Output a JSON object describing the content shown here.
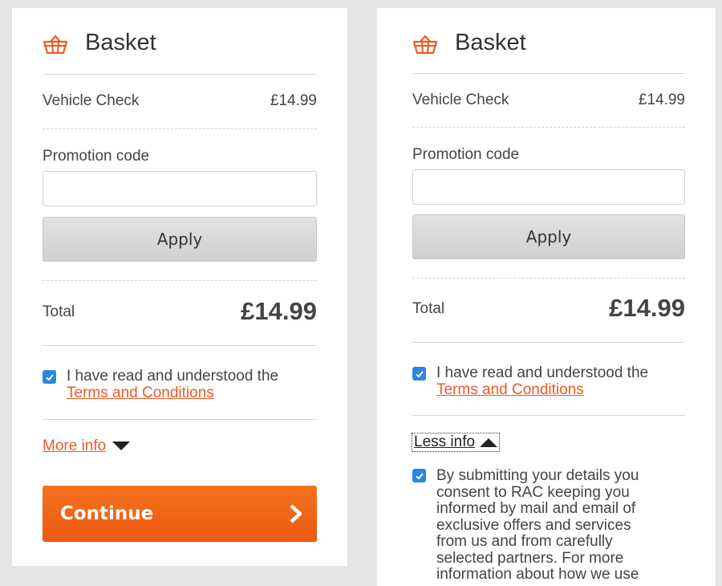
{
  "colors": {
    "accent": "#ee5a24",
    "checkbox": "#2a86e0",
    "continue_button": "#f26a1b",
    "apply_button": "#d8d8d8"
  },
  "left_panel": {
    "title": "Basket",
    "icon": "basket-icon",
    "item": {
      "label": "Vehicle Check",
      "price": "£14.99"
    },
    "promotion": {
      "label": "Promotion code",
      "value": "",
      "placeholder": ""
    },
    "apply_label": "Apply",
    "total": {
      "label": "Total",
      "value": "£14.99"
    },
    "terms": {
      "text": "I have read and understood the",
      "link": "Terms and Conditions",
      "checked": true
    },
    "more_info_label": "More info",
    "continue_label": "Continue"
  },
  "right_panel": {
    "title": "Basket",
    "icon": "basket-icon",
    "item": {
      "label": "Vehicle Check",
      "price": "£14.99"
    },
    "promotion": {
      "label": "Promotion code",
      "value": "",
      "placeholder": ""
    },
    "apply_label": "Apply",
    "total": {
      "label": "Total",
      "value": "£14.99"
    },
    "terms": {
      "text": "I have read and understood the",
      "link": "Terms and Conditions",
      "checked": true
    },
    "less_info_label": "Less info",
    "marketing": {
      "checked": true,
      "lines": [
        "By submitting your details you",
        "consent to RAC keeping you",
        "informed by mail and email of",
        "exclusive offers and services",
        "from us and from carefully",
        "selected partners. For more",
        "information about how we use"
      ]
    }
  }
}
